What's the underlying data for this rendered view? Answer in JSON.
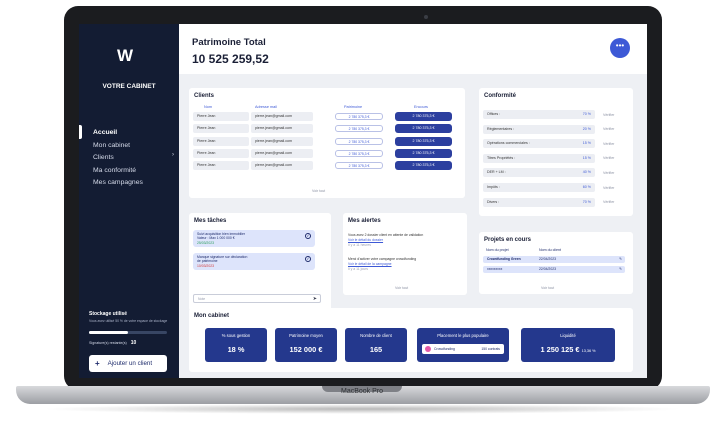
{
  "brand": "MacBook Pro",
  "sidebar": {
    "logo": "W",
    "cabinet_title": "VOTRE CABINET",
    "nav": [
      "Accueil",
      "Mon cabinet",
      "Clients",
      "Ma conformité",
      "Mes campagnes"
    ],
    "storage_title": "Stockage utilisé",
    "storage_sub": "Vous avez utilisé 50 % de votre espace de stockage",
    "storage_fraction": 0.5,
    "sig_label": "Signature(s) restante(s)",
    "sig_value": "10",
    "add_client": "Ajouter un client"
  },
  "header": {
    "title": "Patrimoine Total",
    "value": "10 525 259,52"
  },
  "clients": {
    "title": "Clients",
    "headers": [
      "Nom",
      "Adresse mail",
      "Patrimoine",
      "Encours"
    ],
    "rows": [
      {
        "nom": "Pierre Jean",
        "mail": "pierre.jean@gmail.com",
        "patrimoine": "2 780 375,3 €",
        "encours": "2 780 375,3 €"
      },
      {
        "nom": "Pierre Jean",
        "mail": "pierre.jean@gmail.com",
        "patrimoine": "2 780 375,3 €",
        "encours": "2 780 375,3 €"
      },
      {
        "nom": "Pierre Jean",
        "mail": "pierre.jean@gmail.com",
        "patrimoine": "2 780 375,3 €",
        "encours": "2 780 375,3 €"
      },
      {
        "nom": "Pierre Jean",
        "mail": "pierre.jean@gmail.com",
        "patrimoine": "2 780 375,3 €",
        "encours": "2 780 375,3 €"
      },
      {
        "nom": "Pierre Jean",
        "mail": "pierre.jean@gmail.com",
        "patrimoine": "2 780 375,3 €",
        "encours": "2 780 375,3 €"
      }
    ],
    "link": "Voir tout"
  },
  "conformite": {
    "title": "Conformité",
    "rows": [
      {
        "label": "Offices :",
        "pct": "70 %",
        "link": "Vérifier"
      },
      {
        "label": "Réglementaires :",
        "pct": "20 %",
        "link": "Vérifier"
      },
      {
        "label": "Opérations commerciales :",
        "pct": "15 %",
        "link": "Vérifier"
      },
      {
        "label": "Titres Propriétés :",
        "pct": "15 %",
        "link": "Vérifier"
      },
      {
        "label": "DER + LM :",
        "pct": "40 %",
        "link": "Vérifier"
      },
      {
        "label": "Impôts :",
        "pct": "60 %",
        "link": "Vérifier"
      },
      {
        "label": "Divers :",
        "pct": "70 %",
        "link": "Vérifier"
      }
    ]
  },
  "taches": {
    "title": "Mes tâches",
    "items": [
      {
        "l1": "Suivi acquisition bien immobilier",
        "l2": "Valeur : Max 1 000 000 €",
        "l3": "25/03/2023"
      },
      {
        "l1": "Manque signature sur déclaration",
        "l2": "de patrimoine",
        "l3": "10/03/2023"
      }
    ],
    "placeholder": "Note"
  },
  "alertes": {
    "title": "Mes alertes",
    "items": [
      {
        "l1": "Vous avez 2 dossier client en attente de validation",
        "l2": "Voir le détail du dossier",
        "l3": "Il y a 11 heures"
      },
      {
        "l1": "Merci d'activer votre campagne crowdfunding",
        "l2": "Voir le détail de la campagne",
        "l3": "Il y a 11 jours"
      }
    ],
    "link": "Voir tout"
  },
  "projets": {
    "title": "Projets en cours",
    "headers": [
      "Nom du projet",
      "Nom du client"
    ],
    "rows": [
      {
        "projet": "Crowdfunding Green",
        "date": "22/04/2023"
      },
      {
        "projet": "xxxxxxxxx",
        "date": "22/04/2023"
      }
    ],
    "link": "Voir tout"
  },
  "cabinet": {
    "title": "Mon cabinet",
    "kpis": [
      {
        "label": "% sous gestion",
        "value": "18 %"
      },
      {
        "label": "Patrimoine moyen",
        "value": "152 000 €"
      },
      {
        "label": "Nombre de client",
        "value": "165"
      }
    ],
    "popular": {
      "label": "Placement le plus populaire",
      "name": "Crowdfunding",
      "count": "150 contrats"
    },
    "liquidite": {
      "label": "Liquidité",
      "value": "1 250 125 €",
      "pct": "13,36 %"
    }
  }
}
